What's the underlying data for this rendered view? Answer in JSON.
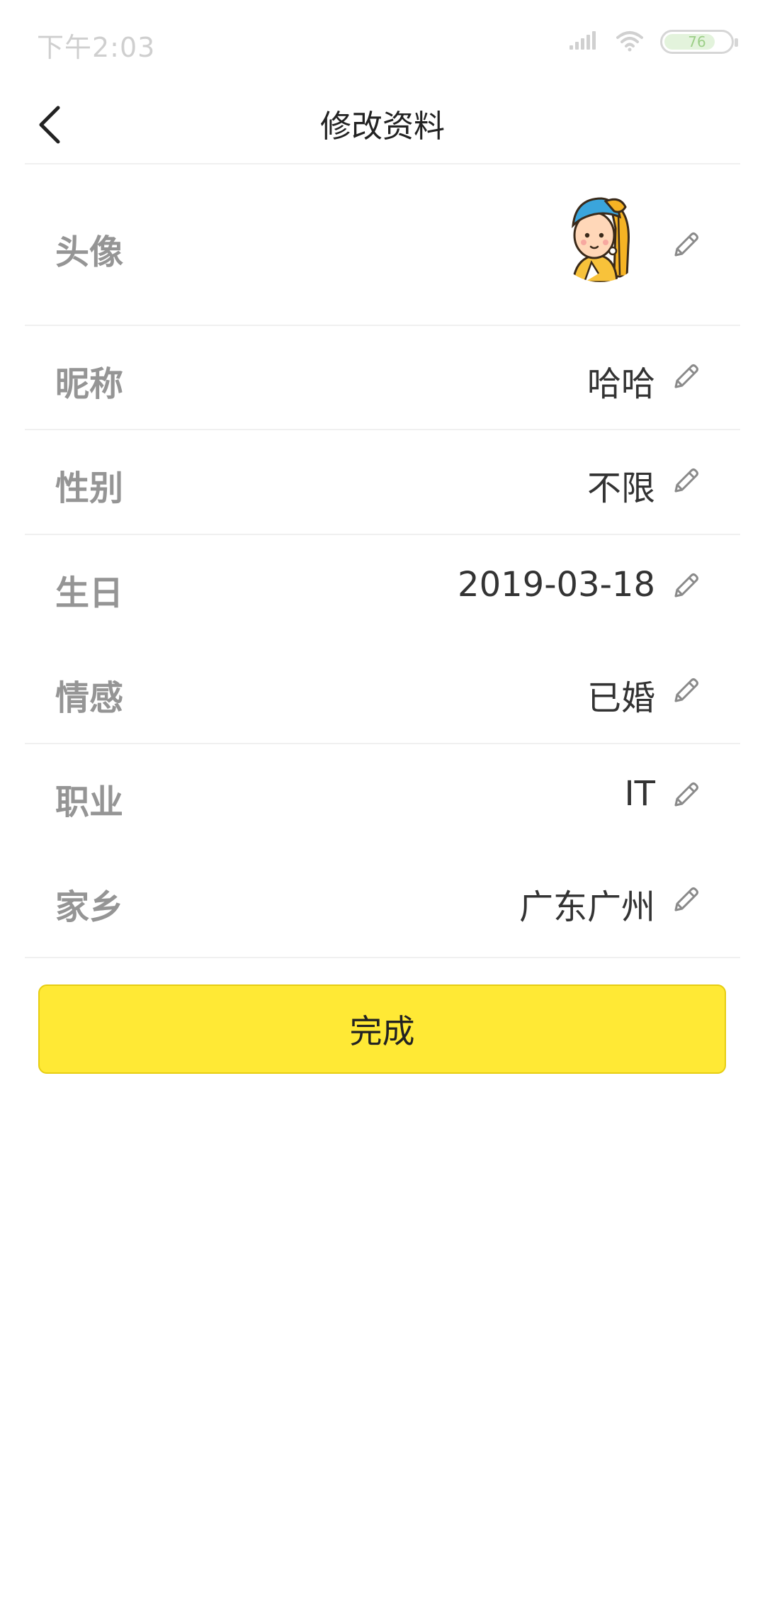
{
  "status_bar": {
    "time": "下午2:03",
    "battery": "76"
  },
  "header": {
    "title": "修改资料"
  },
  "rows": {
    "avatar": {
      "label": "头像"
    },
    "nickname": {
      "label": "昵称",
      "value": "哈哈"
    },
    "gender": {
      "label": "性别",
      "value": "不限"
    },
    "birthday": {
      "label": "生日",
      "value": "2019-03-18"
    },
    "relationship": {
      "label": "情感",
      "value": "已婚"
    },
    "job": {
      "label": "职业",
      "value": "IT"
    },
    "hometown": {
      "label": "家乡",
      "value": "广东广州"
    }
  },
  "buttons": {
    "done": "完成"
  },
  "colors": {
    "accent": "#ffe935",
    "label": "#959595",
    "value": "#333333"
  },
  "icons": {
    "back": "chevron-left-icon",
    "edit": "pencil-icon",
    "signal": "signal-icon",
    "wifi": "wifi-icon"
  }
}
